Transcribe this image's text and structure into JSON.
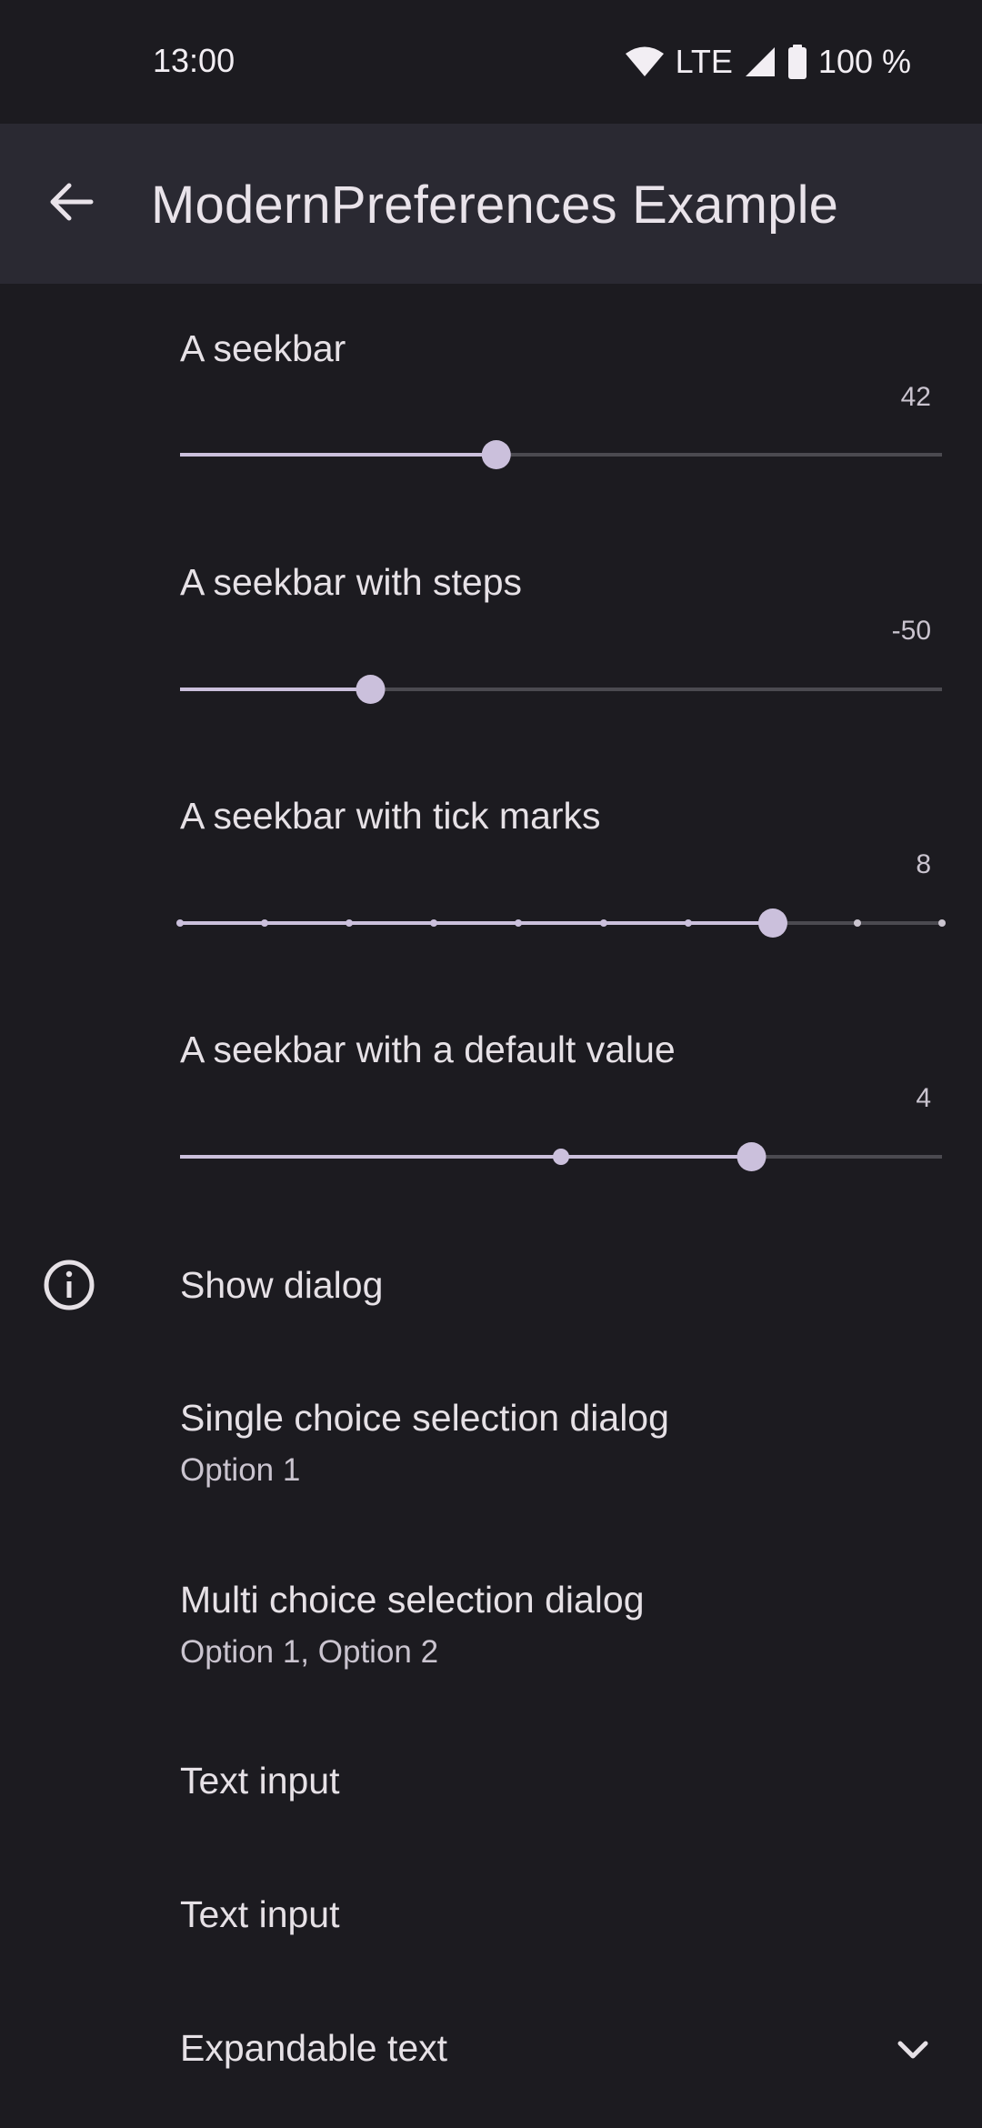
{
  "status_bar": {
    "time": "13:00",
    "network": "LTE",
    "battery": "100 %"
  },
  "app_bar": {
    "title": "ModernPreferences Example",
    "back_icon": "arrow-back-icon"
  },
  "colors": {
    "background": "#1c1b20",
    "app_bar": "#2a2932",
    "accent": "#cbc0dc",
    "track_inactive": "#4b4a50"
  },
  "seekbars": [
    {
      "title": "A seekbar",
      "value_label": "42",
      "fraction": 0.415,
      "ticks": [],
      "default_marker": null
    },
    {
      "title": "A seekbar with steps",
      "value_label": "-50",
      "fraction": 0.25,
      "ticks": [],
      "default_marker": null
    },
    {
      "title": "A seekbar with tick marks",
      "value_label": "8",
      "fraction": 0.778,
      "ticks": [
        0,
        0.111,
        0.222,
        0.333,
        0.444,
        0.556,
        0.667,
        0.778,
        0.889,
        1
      ],
      "default_marker": null
    },
    {
      "title": "A seekbar with a default value",
      "value_label": "4",
      "fraction": 0.75,
      "ticks": [],
      "default_marker": 0.5
    }
  ],
  "preferences": {
    "show_dialog": {
      "title": "Show dialog",
      "icon": "info-icon"
    },
    "single_choice": {
      "title": "Single choice selection dialog",
      "summary": "Option 1"
    },
    "multi_choice": {
      "title": "Multi choice selection dialog",
      "summary": "Option 1, Option 2"
    },
    "text_input_1": {
      "title": "Text input"
    },
    "text_input_2": {
      "title": "Text input"
    },
    "expandable": {
      "title": "Expandable text",
      "icon": "chevron-down-icon"
    }
  }
}
